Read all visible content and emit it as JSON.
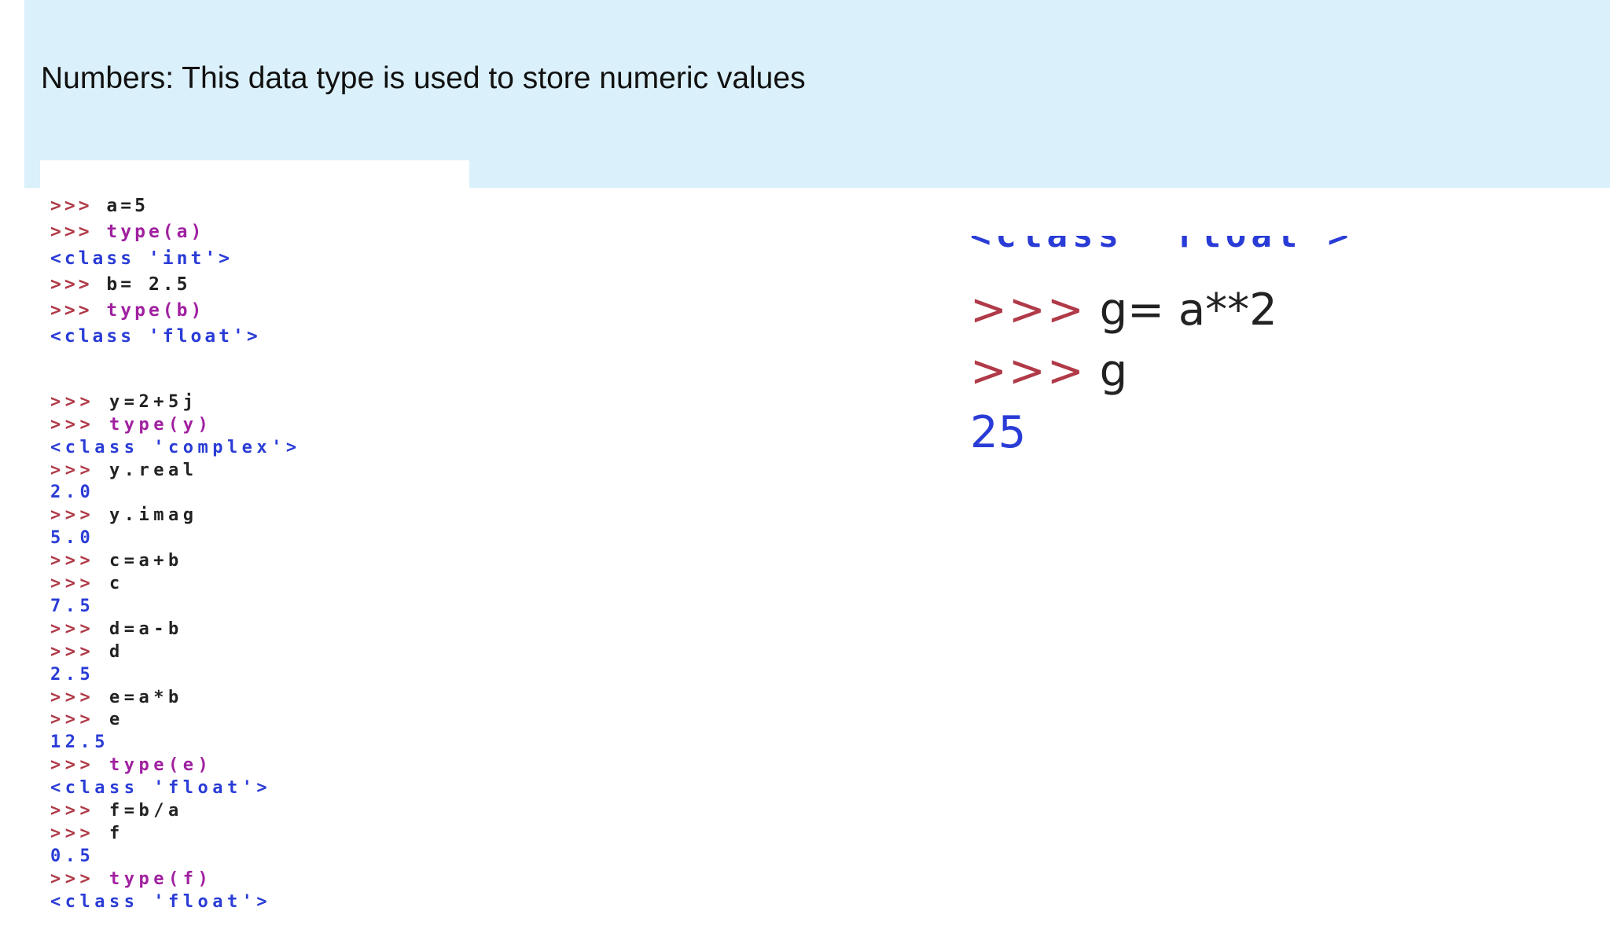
{
  "slide": {
    "title": "Numbers: This data type is used to store numeric values"
  },
  "code_left": {
    "group1": [
      {
        "prompt": ">>>",
        "text": "a=5",
        "kind": "plain"
      },
      {
        "prompt": ">>>",
        "text": "type(a)",
        "kind": "kw"
      },
      {
        "prompt": "",
        "text": "<class 'int'>",
        "kind": "out"
      },
      {
        "prompt": ">>>",
        "text": "b= 2.5",
        "kind": "plain"
      },
      {
        "prompt": ">>>",
        "text": "type(b)",
        "kind": "kw"
      },
      {
        "prompt": "",
        "text": "<class 'float'>",
        "kind": "out"
      }
    ],
    "group2": [
      {
        "prompt": ">>>",
        "text": "y=2+5j",
        "kind": "plain"
      },
      {
        "prompt": ">>>",
        "text": "type(y)",
        "kind": "kw"
      },
      {
        "prompt": "",
        "text": "<class 'complex'>",
        "kind": "out"
      },
      {
        "prompt": ">>>",
        "text": "y.real",
        "kind": "plain"
      },
      {
        "prompt": "",
        "text": "2.0",
        "kind": "out"
      },
      {
        "prompt": ">>>",
        "text": "y.imag",
        "kind": "plain"
      },
      {
        "prompt": "",
        "text": "5.0",
        "kind": "out"
      },
      {
        "prompt": ">>>",
        "text": "c=a+b",
        "kind": "plain"
      },
      {
        "prompt": ">>>",
        "text": "c",
        "kind": "plain"
      },
      {
        "prompt": "",
        "text": "7.5",
        "kind": "out"
      },
      {
        "prompt": ">>>",
        "text": "d=a-b",
        "kind": "plain"
      },
      {
        "prompt": ">>>",
        "text": "d",
        "kind": "plain"
      },
      {
        "prompt": "",
        "text": "2.5",
        "kind": "out"
      },
      {
        "prompt": ">>>",
        "text": "e=a*b",
        "kind": "plain"
      },
      {
        "prompt": ">>>",
        "text": "e",
        "kind": "plain"
      },
      {
        "prompt": "",
        "text": "12.5",
        "kind": "out"
      },
      {
        "prompt": ">>>",
        "text": "type(e)",
        "kind": "kw"
      },
      {
        "prompt": "",
        "text": "<class 'float'>",
        "kind": "out"
      },
      {
        "prompt": ">>>",
        "text": "f=b/a",
        "kind": "plain"
      },
      {
        "prompt": ">>>",
        "text": "f",
        "kind": "plain"
      },
      {
        "prompt": "",
        "text": "0.5",
        "kind": "out"
      },
      {
        "prompt": ">>>",
        "text": "type(f)",
        "kind": "kw"
      },
      {
        "prompt": "",
        "text": "<class 'float'>",
        "kind": "out"
      }
    ]
  },
  "code_right": {
    "cut_line": "<class 'float'>",
    "lines": [
      {
        "prompt": ">>>",
        "text": "g= a**2",
        "kind": "plain"
      },
      {
        "prompt": ">>>",
        "text": "g",
        "kind": "plain"
      },
      {
        "prompt": "",
        "text": "25",
        "kind": "out"
      }
    ]
  },
  "colors": {
    "header_band": "#daf0fa",
    "prompt": "#b03a48",
    "keyword_call": "#a020a0",
    "output": "#2a3cd6"
  }
}
